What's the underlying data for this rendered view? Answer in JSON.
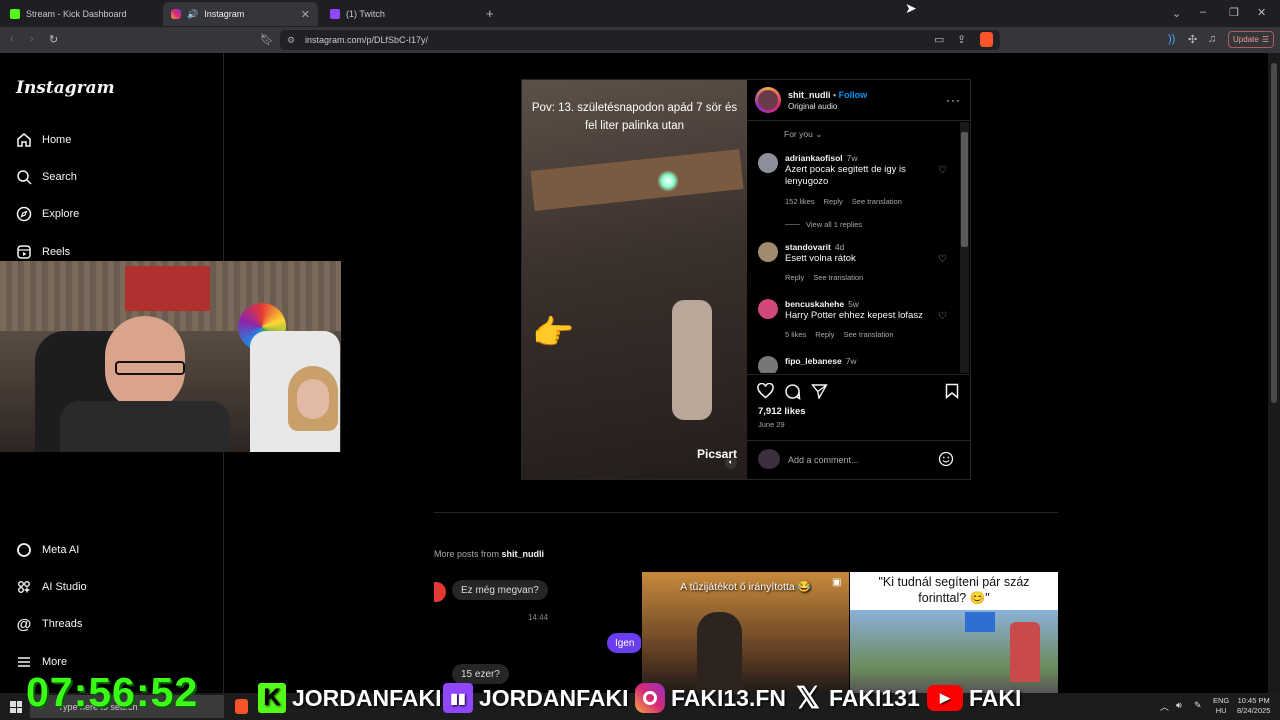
{
  "browser": {
    "tabs": [
      {
        "title": "Stream - Kick Dashboard"
      },
      {
        "title": "Instagram"
      },
      {
        "title": "(1) Twitch"
      }
    ],
    "url": "instagram.com/p/DLfSbC-I17y/",
    "update_label": "Update"
  },
  "sidebar": {
    "logo": "Instagram",
    "nav_top": [
      {
        "label": "Home",
        "icon": "home-icon"
      },
      {
        "label": "Search",
        "icon": "search-icon"
      },
      {
        "label": "Explore",
        "icon": "compass-icon"
      },
      {
        "label": "Reels",
        "icon": "reels-icon"
      }
    ],
    "nav_bottom": [
      {
        "label": "Meta AI",
        "icon": "meta-ai-icon"
      },
      {
        "label": "AI Studio",
        "icon": "ai-studio-icon"
      },
      {
        "label": "Threads",
        "icon": "threads-icon"
      },
      {
        "label": "More",
        "icon": "menu-icon"
      }
    ]
  },
  "post": {
    "caption": "Pov: 13. születésnapodon apád 7 sör és fel liter palinka utan",
    "watermark": "Picsart",
    "author": "shit_nudli",
    "follow_label": "Follow",
    "audio": "Original audio",
    "sort_label": "For you",
    "comments": [
      {
        "user": "adriankaofisol",
        "when": "7w",
        "text": "Azert pocak segitett de igy is lenyugozo",
        "likes": "152 likes",
        "reply": "Reply",
        "translate": "See translation",
        "view_replies": "View all 1 replies",
        "avatar_color": "#8a8f99"
      },
      {
        "user": "standovarit",
        "when": "4d",
        "text": "Esett volna rátok",
        "reply": "Reply",
        "translate": "See translation",
        "avatar_color": "#a08b6d"
      },
      {
        "user": "bencuskahehe",
        "when": "5w",
        "text": "Harry Potter ehhez kepest lofasz",
        "likes": "5 likes",
        "reply": "Reply",
        "translate": "See translation",
        "avatar_color": "#d0487a"
      },
      {
        "user": "fipo_lebanese",
        "when": "7w",
        "text": "",
        "avatar_color": "#777777"
      }
    ],
    "likes": "7,912 likes",
    "date": "June 29",
    "add_comment_placeholder": "Add a comment..."
  },
  "more_posts": {
    "prefix": "More posts from",
    "author": "shit_nudli",
    "items": [
      {
        "bubble1": "Ez még megvan?",
        "time": "14:44",
        "bubble2": "Igen",
        "bubble3": "15 ezer?"
      },
      {
        "overlay": "A tűzijátékot ő irányította 😂"
      },
      {
        "overlay": "\"Ki tudnál segíteni pár száz forinttal? 😊\""
      }
    ]
  },
  "stream_overlay": {
    "clock": "07:56:52",
    "socials": [
      {
        "platform": "kick",
        "handle": "JORDANFAKI"
      },
      {
        "platform": "twitch",
        "handle": "JORDANFAKI"
      },
      {
        "platform": "instagram",
        "handle": "FAKI13.FN"
      },
      {
        "platform": "x",
        "handle": "FAKI131"
      },
      {
        "platform": "youtube",
        "handle": "FAKI"
      }
    ]
  },
  "taskbar": {
    "search_placeholder": "Type here to search",
    "lang1": "ENG",
    "lang2": "HU",
    "time": "10:45 PM",
    "date": "8/24/2025"
  },
  "colors": {
    "kick_green": "#53fc18",
    "clock_green": "#39ff14",
    "instagram_blue": "#0095f6",
    "twitch_purple": "#9146ff",
    "youtube_red": "#ff0000"
  }
}
